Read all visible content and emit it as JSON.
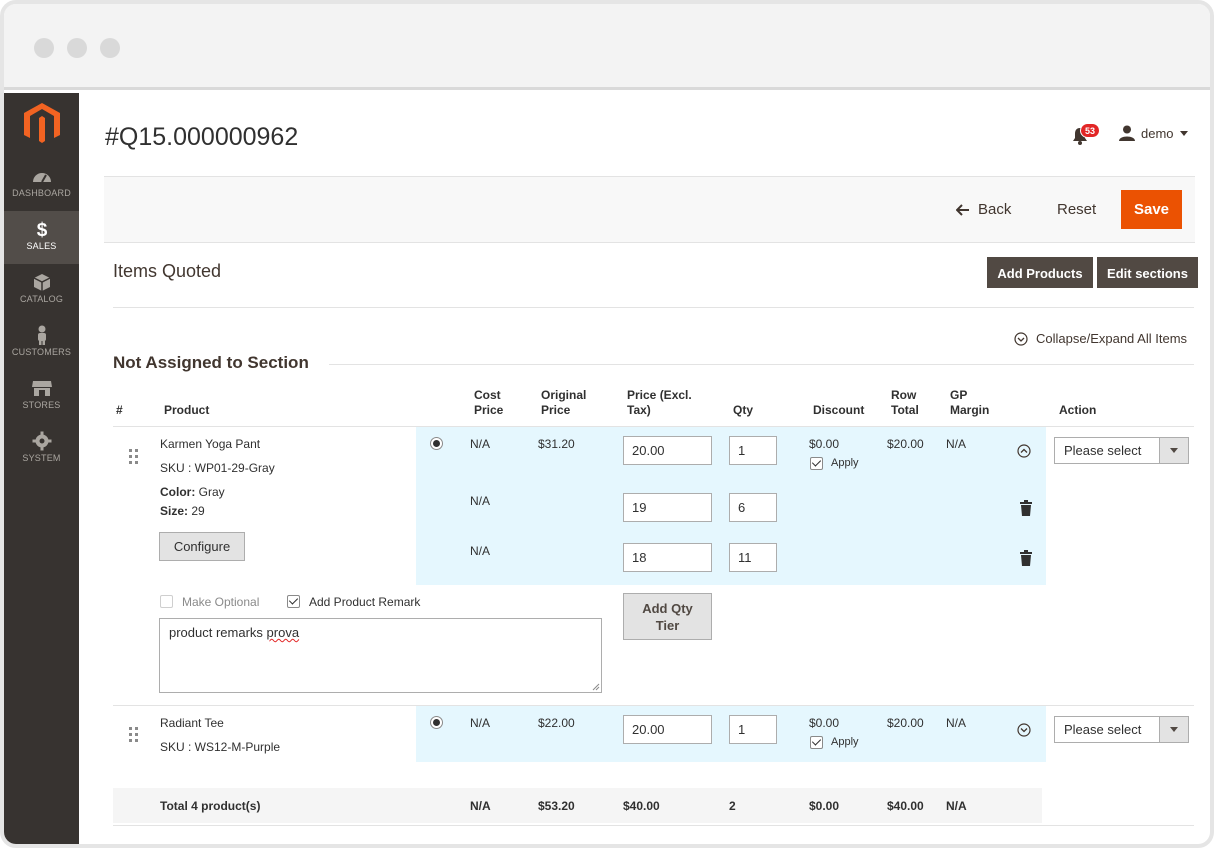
{
  "sidebar": {
    "items": [
      {
        "label": "DASHBOARD",
        "icon": "dashboard-icon"
      },
      {
        "label": "SALES",
        "icon": "dollar-icon"
      },
      {
        "label": "CATALOG",
        "icon": "cube-icon"
      },
      {
        "label": "CUSTOMERS",
        "icon": "person-icon"
      },
      {
        "label": "STORES",
        "icon": "store-icon"
      },
      {
        "label": "SYSTEM",
        "icon": "gear-icon"
      }
    ]
  },
  "header": {
    "title": "#Q15.000000962",
    "notifications_count": "53",
    "user": "demo"
  },
  "actions": {
    "back": "Back",
    "reset": "Reset",
    "save": "Save"
  },
  "section": {
    "title": "Items Quoted",
    "add_products": "Add Products",
    "edit_sections": "Edit sections",
    "collapse_all": "Collapse/Expand All Items",
    "group_title": "Not Assigned to Section"
  },
  "columns": {
    "num": "#",
    "product": "Product",
    "cost_price_1": "Cost",
    "cost_price_2": "Price",
    "original_price_1": "Original",
    "original_price_2": "Price",
    "price_1": "Price (Excl.",
    "price_2": "Tax)",
    "qty": "Qty",
    "discount": "Discount",
    "row_total_1": "Row",
    "row_total_2": "Total",
    "gp_margin_1": "GP",
    "gp_margin_2": "Margin",
    "action": "Action"
  },
  "items": [
    {
      "name": "Karmen Yoga Pant",
      "sku": "SKU : WP01-29-Gray",
      "color_label": "Color:",
      "color": "Gray",
      "size_label": "Size:",
      "size": "29",
      "configure": "Configure",
      "cost_price": "N/A",
      "original_price": "$31.20",
      "price": "20.00",
      "qty": "1",
      "discount": "$0.00",
      "apply": "Apply",
      "row_total": "$20.00",
      "gp_margin": "N/A",
      "action_select": "Please select",
      "tiers": [
        {
          "cost_price": "N/A",
          "price": "19",
          "qty": "6"
        },
        {
          "cost_price": "N/A",
          "price": "18",
          "qty": "11"
        }
      ],
      "make_optional": "Make Optional",
      "add_remark": "Add Product Remark",
      "remark_text_1": "product remarks ",
      "remark_text_2": "prova",
      "add_qty_tier_1": "Add Qty",
      "add_qty_tier_2": "Tier"
    },
    {
      "name": "Radiant Tee",
      "sku": "SKU : WS12-M-Purple",
      "cost_price": "N/A",
      "original_price": "$22.00",
      "price": "20.00",
      "qty": "1",
      "discount": "$0.00",
      "apply": "Apply",
      "row_total": "$20.00",
      "gp_margin": "N/A",
      "action_select": "Please select"
    }
  ],
  "totals": {
    "label": "Total 4 product(s)",
    "cost_price": "N/A",
    "original_price": "$53.20",
    "price": "$40.00",
    "qty": "2",
    "discount": "$0.00",
    "row_total": "$40.00",
    "gp_margin": "N/A"
  }
}
